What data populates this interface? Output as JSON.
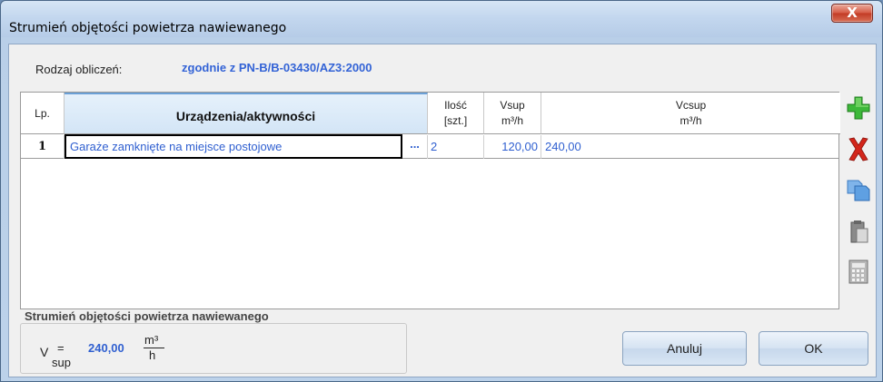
{
  "window": {
    "title": "Strumień objętości powietrza nawiewanego",
    "close_label": "X"
  },
  "calc_type": {
    "label": "Rodzaj obliczeń:",
    "value": "zgodnie z PN-B/B-03430/AZ3:2000"
  },
  "table": {
    "headers": {
      "lp": "Lp.",
      "device": "Urządzenia/aktywności",
      "qty_line1": "Ilość",
      "qty_line2": "[szt.]",
      "vsup_line1": "Vsup",
      "vsup_line2": "m³/h",
      "vcsup_line1": "Vcsup",
      "vcsup_line2": "m³/h"
    },
    "rows": [
      {
        "lp": "1",
        "device": "Garaże zamknięte na miejsce postojowe",
        "dots": "...",
        "qty": "2",
        "vsup": "120,00",
        "vcsup": "240,00"
      }
    ]
  },
  "tools": [
    "add-icon",
    "delete-icon",
    "copy-icon",
    "paste-icon",
    "calculator-icon"
  ],
  "result": {
    "title": "Strumień objętości powietrza nawiewanego",
    "symbol": "V",
    "subscript": "sup",
    "equals": "=",
    "value": "240,00",
    "unit_top": "m³",
    "unit_bottom": "h"
  },
  "buttons": {
    "cancel": "Anuluj",
    "ok": "OK"
  },
  "colors": {
    "accent_blue": "#2f5fd0",
    "add_green": "#3db83a",
    "delete_red": "#d3261b"
  }
}
